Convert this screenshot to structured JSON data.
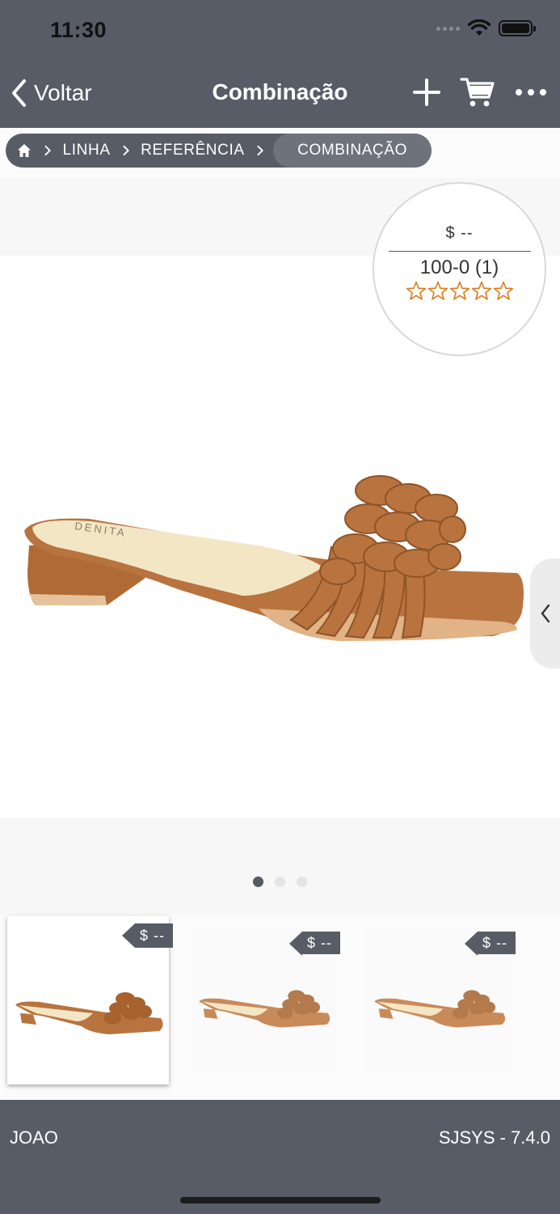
{
  "status_bar": {
    "time": "11:30"
  },
  "nav": {
    "back_label": "Voltar",
    "title": "Combinação",
    "icons": [
      "plus-icon",
      "cart-icon",
      "more-icon"
    ]
  },
  "breadcrumb": {
    "items": [
      "LINHA",
      "REFERÊNCIA"
    ],
    "active": "COMBINAÇÃO"
  },
  "product": {
    "price": "$ --",
    "code": "100-0 (1)",
    "rating": 0,
    "rating_max": 5,
    "brand_imprint": "DENITA",
    "colors": {
      "leather": "#b8733f",
      "insole": "#f3e6c4",
      "accent": "#e07b1a"
    }
  },
  "carousel": {
    "pages": 3,
    "current": 1
  },
  "thumbnails": [
    {
      "price": "$ --",
      "selected": true
    },
    {
      "price": "$ --",
      "selected": false
    },
    {
      "price": "$ --",
      "selected": false
    }
  ],
  "footer": {
    "user": "JOAO",
    "version": "SJSYS - 7.4.0"
  },
  "theme": {
    "bar": "#585c66",
    "background": "#fbfbfb"
  }
}
